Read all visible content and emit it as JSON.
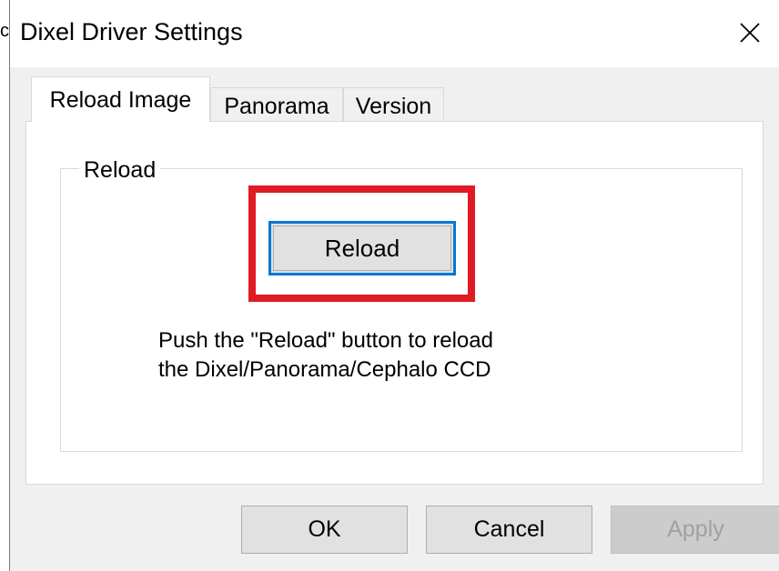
{
  "stray_glyph": "c",
  "window": {
    "title": "Dixel Driver Settings",
    "close_icon": "close-icon"
  },
  "tabs": [
    {
      "label": "Reload Image",
      "active": true
    },
    {
      "label": "Panorama",
      "active": false
    },
    {
      "label": "Version",
      "active": false
    }
  ],
  "reload_group": {
    "legend": "Reload",
    "button_label": "Reload",
    "instruction_line1": "Push the \"Reload\" button to reload",
    "instruction_line2": "the Dixel/Panorama/Cephalo CCD"
  },
  "footer": {
    "ok_label": "OK",
    "cancel_label": "Cancel",
    "apply_label": "Apply",
    "apply_enabled": false
  },
  "colors": {
    "highlight": "#e01b24",
    "focus_border": "#0078d7",
    "dialog_bg": "#f0f0f0"
  }
}
